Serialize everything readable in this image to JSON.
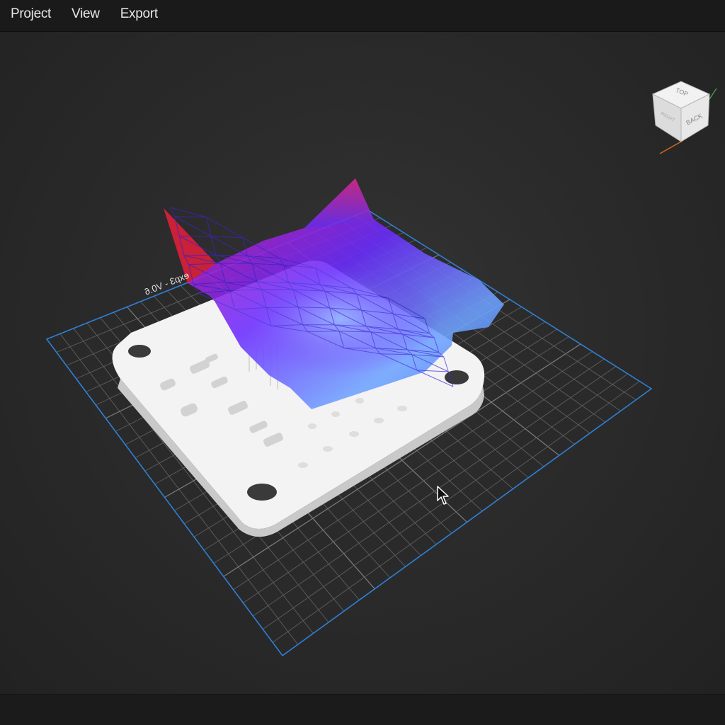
{
  "menu": {
    "items": [
      {
        "label": "Project"
      },
      {
        "label": "View"
      },
      {
        "label": "Export"
      }
    ]
  },
  "view_cube": {
    "faces": {
      "top": "TOP",
      "front": "BACK",
      "side": "RIGHT"
    }
  },
  "mesh_label": "exp3 - V0.6",
  "colors": {
    "background": "#2b2b2b",
    "menubar": "#1a1a1a",
    "grid_line": "#6e6e6e",
    "grid_border": "#2f7fd6",
    "model": "#f7f7f7",
    "surface_low": "#6ea8ff",
    "surface_mid": "#6b2cff",
    "surface_high": "#e0238a",
    "surface_peak": "#e8201e"
  },
  "icons": [
    "view-cube-icon",
    "mouse-cursor-icon"
  ]
}
